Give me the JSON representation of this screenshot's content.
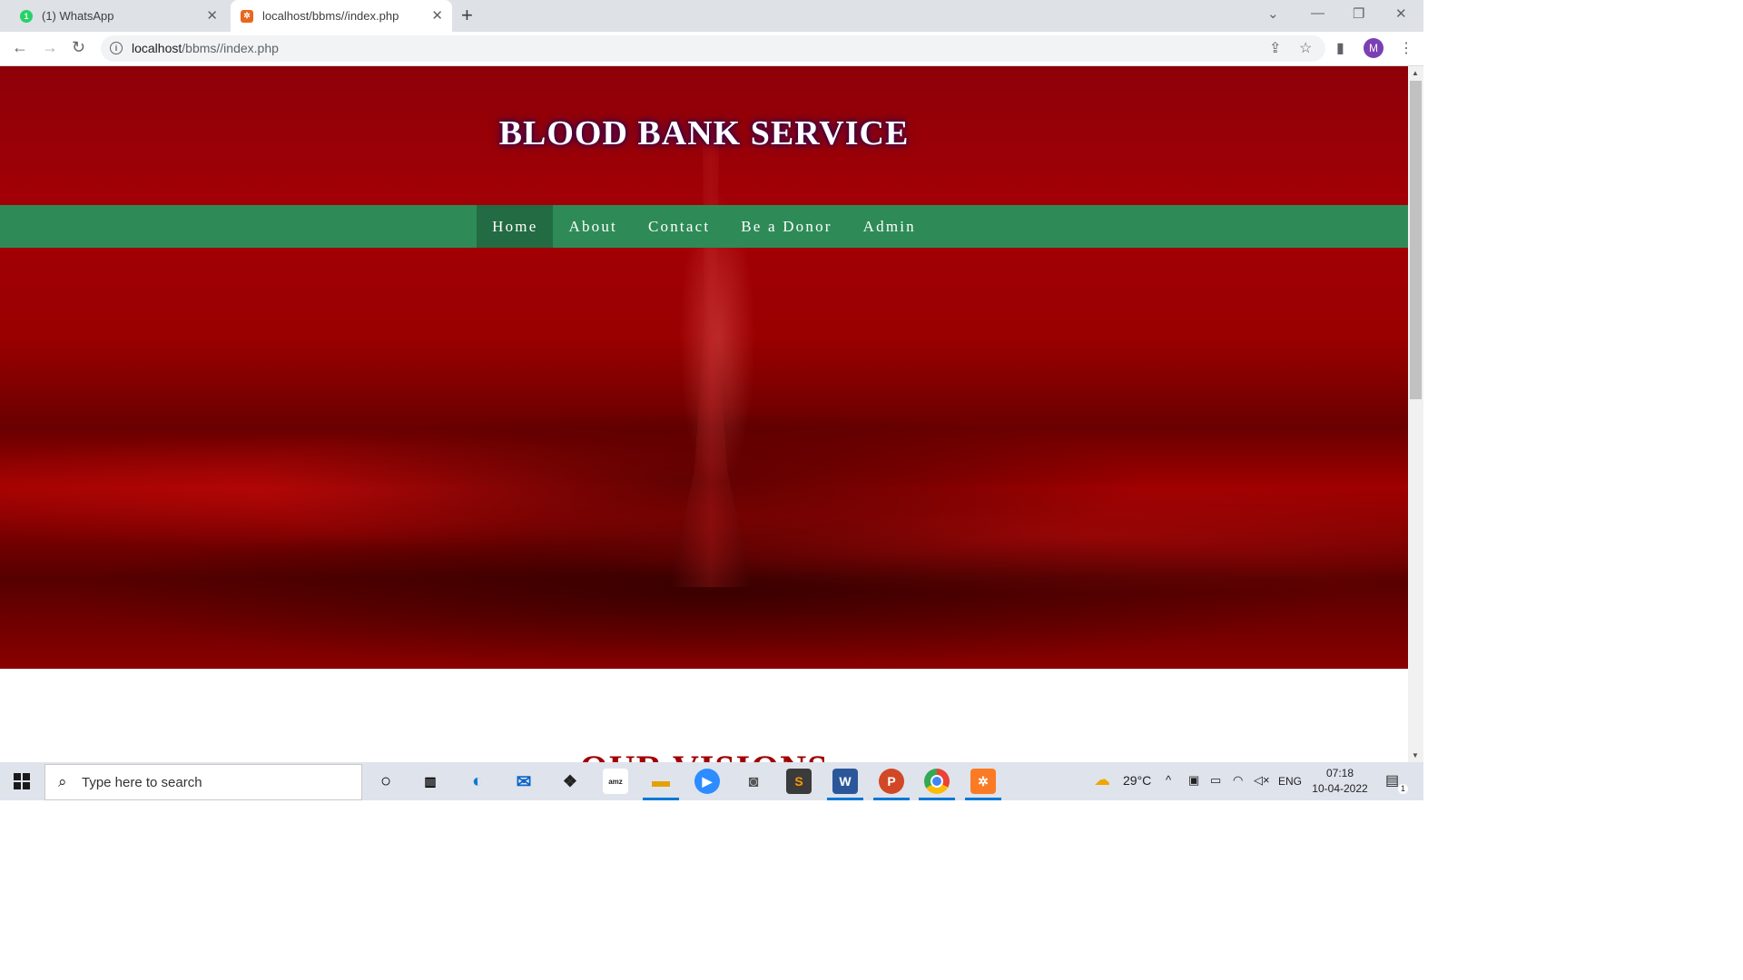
{
  "browser": {
    "tabs": [
      {
        "title": "(1) WhatsApp",
        "active": false,
        "badge": "1"
      },
      {
        "title": "localhost/bbms//index.php",
        "active": true
      }
    ],
    "new_tab_label": "+",
    "url_host": "localhost",
    "url_path": "/bbms//index.php",
    "profile_initial": "M"
  },
  "site": {
    "title": "BLOOD BANK SERVICE",
    "nav": [
      {
        "label": "Home",
        "active": true
      },
      {
        "label": "About"
      },
      {
        "label": "Contact"
      },
      {
        "label": "Be a Donor"
      },
      {
        "label": "Admin"
      }
    ],
    "section_heading": "OUR VISIONS"
  },
  "taskbar": {
    "search_placeholder": "Type here to search",
    "weather": "29°C",
    "language": "ENG",
    "time": "07:18",
    "date": "10-04-2022",
    "notification_count": "1"
  },
  "colors": {
    "nav_bg": "#2e8b57",
    "nav_active": "#236b42",
    "hero_red": "#9a0000",
    "heading_red": "#a00000"
  }
}
